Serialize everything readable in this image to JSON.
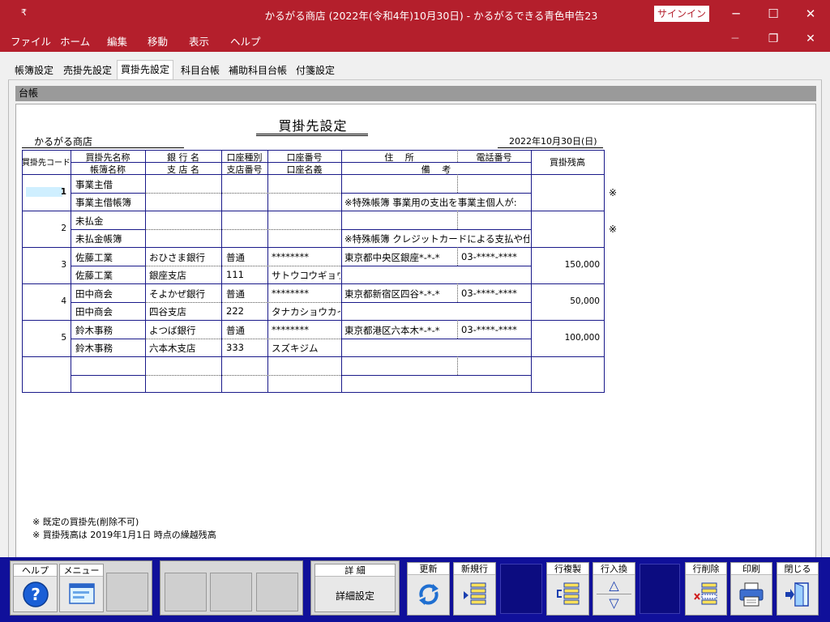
{
  "window": {
    "qa_icon": "₹",
    "title": "かるがる商店 (2022年(令和4年)10月30日) - かるがるできる青色申告23",
    "signin": "サインイン",
    "minimize": "─",
    "maximize": "☐",
    "close": "✕"
  },
  "menu": {
    "items": [
      "ファイル",
      "ホーム",
      "編集",
      "移動",
      "表示",
      "ヘルプ"
    ],
    "mdi_min": "─",
    "mdi_restore": "❐",
    "mdi_close": "✕"
  },
  "tabs": [
    "帳簿設定",
    "売掛先設定",
    "買掛先設定",
    "科目台帳",
    "補助科目台帳",
    "付箋設定"
  ],
  "active_tab": "買掛先設定",
  "section": "台帳",
  "doc": {
    "title": "買掛先設定",
    "company": "かるがる商店",
    "date": "2022年10月30日(日)"
  },
  "table": {
    "headers": {
      "code": "買掛先コード",
      "name1": "買掛先名称",
      "name2": "帳簿名称",
      "bank1": "銀 行 名",
      "bank2": "支 店 名",
      "type1": "口座種別",
      "type2": "支店番号",
      "acct1": "口座番号",
      "acct2": "口座名義",
      "addr1": "住　 所",
      "tel1": "電話番号",
      "memo": "備　 考",
      "balance": "買掛残高"
    },
    "rows": [
      {
        "code": "1",
        "name": "事業主借",
        "book": "事業主借帳簿",
        "bank": "",
        "branch": "",
        "type": "",
        "branch_no": "",
        "acct": "",
        "holder": "",
        "addr": "",
        "tel": "",
        "memo": "※特殊帳簿 事業用の支出を事業主個人が:",
        "balance": "",
        "mark": "※"
      },
      {
        "code": "2",
        "name": "未払金",
        "book": "未払金帳簿",
        "bank": "",
        "branch": "",
        "type": "",
        "branch_no": "",
        "acct": "",
        "holder": "",
        "addr": "",
        "tel": "",
        "memo": "※特殊帳簿 クレジットカードによる支払や仕",
        "balance": "",
        "mark": "※"
      },
      {
        "code": "3",
        "name": "佐藤工業",
        "book": "佐藤工業",
        "bank": "おひさま銀行",
        "branch": "銀座支店",
        "type": "普通",
        "branch_no": "111",
        "acct": "********",
        "holder": "サトウコウギョウ",
        "addr": "東京都中央区銀座*-*-*",
        "tel": "03-****-****",
        "memo": "",
        "balance": "150,000",
        "mark": ""
      },
      {
        "code": "4",
        "name": "田中商会",
        "book": "田中商会",
        "bank": "そよかぜ銀行",
        "branch": "四谷支店",
        "type": "普通",
        "branch_no": "222",
        "acct": "********",
        "holder": "タナカショウカイ",
        "addr": "東京都新宿区四谷*-*-*",
        "tel": "03-****-****",
        "memo": "",
        "balance": "50,000",
        "mark": ""
      },
      {
        "code": "5",
        "name": "鈴木事務",
        "book": "鈴木事務",
        "bank": "よつば銀行",
        "branch": "六本木支店",
        "type": "普通",
        "branch_no": "333",
        "acct": "********",
        "holder": "スズキジム",
        "addr": "東京都港区六本木*-*-*",
        "tel": "03-****-****",
        "memo": "",
        "balance": "100,000",
        "mark": ""
      },
      {
        "code": "",
        "name": "",
        "book": "",
        "bank": "",
        "branch": "",
        "type": "",
        "branch_no": "",
        "acct": "",
        "holder": "",
        "addr": "",
        "tel": "",
        "memo": "",
        "balance": "",
        "mark": ""
      }
    ]
  },
  "notes": [
    "※ 既定の買掛先(削除不可)",
    "※ 買掛残高は 2019年1月1日 時点の繰越残高"
  ],
  "toolbar": {
    "help": "ヘルプ",
    "menu": "メニュー",
    "detail_label": "詳 細",
    "detail_text": "詳細設定",
    "refresh": "更新",
    "new_row": "新規行",
    "copy_row": "行複製",
    "swap_row": "行入換",
    "delete_row": "行削除",
    "print": "印刷",
    "close": "閉じる",
    "help_glyph": "?",
    "up_glyph": "△",
    "down_glyph": "▽"
  },
  "colors": {
    "titlebar": "#b41f2c",
    "toolbar": "#10109a",
    "grid_line": "#1a1a8a"
  }
}
